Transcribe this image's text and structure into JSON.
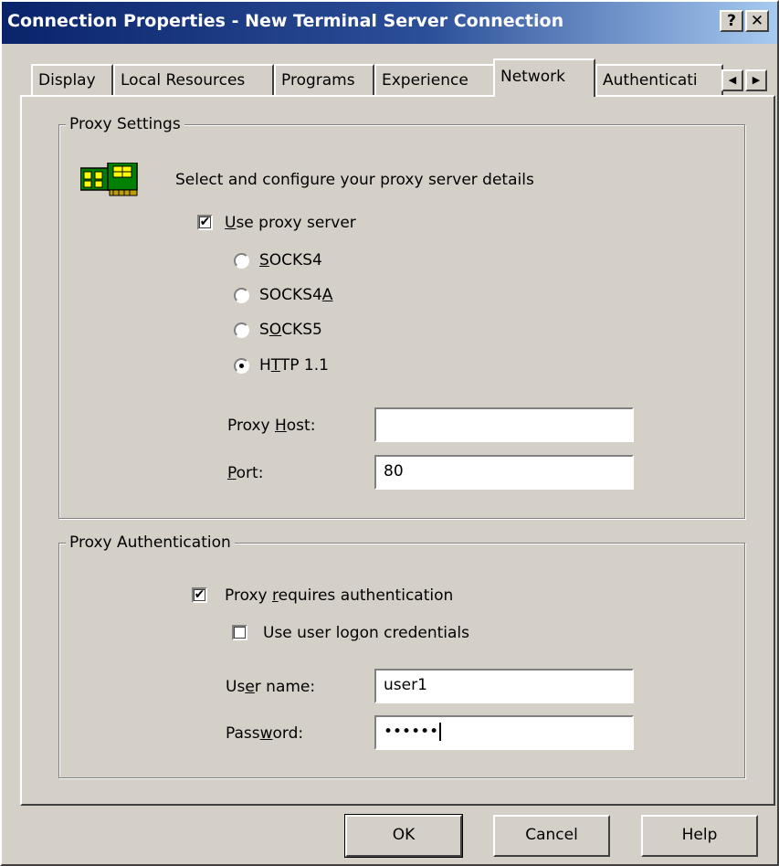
{
  "window": {
    "title": "Connection Properties - New Terminal Server Connection",
    "help_button": "?",
    "close_button": "✕"
  },
  "tabs": [
    {
      "label": "Display"
    },
    {
      "label": "Local Resources"
    },
    {
      "label": "Programs"
    },
    {
      "label": "Experience"
    },
    {
      "label": "Network",
      "active": true
    },
    {
      "label": "Authenticati"
    }
  ],
  "tab_scroll": {
    "left": "◀",
    "right": "▶"
  },
  "proxy_settings": {
    "group_title": "Proxy Settings",
    "icon": "network-card-icon",
    "description": "Select and configure your proxy server details",
    "use_proxy": {
      "pre": "",
      "key": "U",
      "post": "se proxy server",
      "checked": true
    },
    "types": [
      {
        "pre": "",
        "key": "S",
        "post": "OCKS4",
        "selected": false
      },
      {
        "pre": "SOCKS4",
        "key": "A",
        "post": "",
        "selected": false
      },
      {
        "pre": "S",
        "key": "O",
        "post": "CKS5",
        "selected": false
      },
      {
        "pre": "H",
        "key": "T",
        "post": "TP 1.1",
        "selected": true
      }
    ],
    "host_label": {
      "pre": "Proxy ",
      "key": "H",
      "post": "ost:"
    },
    "host_value": "",
    "port_label": {
      "pre": "",
      "key": "P",
      "post": "ort:"
    },
    "port_value": "80"
  },
  "proxy_auth": {
    "group_title": "Proxy Authentication",
    "requires_auth": {
      "pre": "Proxy ",
      "key": "r",
      "post": "equires authentication",
      "checked": true
    },
    "use_logon": {
      "pre": "Use user lo",
      "key": "g",
      "post": "on credentials",
      "checked": false
    },
    "username_label": {
      "pre": "Us",
      "key": "e",
      "post": "r name:"
    },
    "username_value": "user1",
    "password_label": {
      "pre": "Pass",
      "key": "w",
      "post": "ord:"
    },
    "password_value": "••••••"
  },
  "buttons": {
    "ok": "OK",
    "cancel": "Cancel",
    "help": "Help"
  }
}
